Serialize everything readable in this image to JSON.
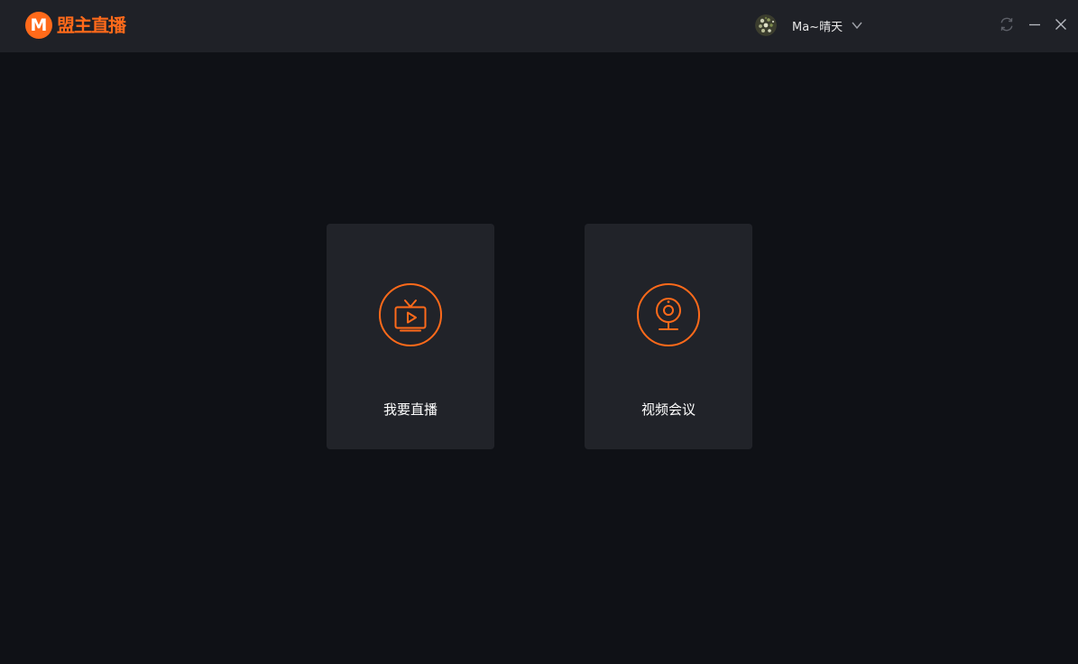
{
  "app": {
    "title": "盟主直播",
    "logo_letter": "M",
    "brand_color": "#ff6a1a"
  },
  "user": {
    "name": "Ma~晴天",
    "avatar_icon": "avatar-image",
    "dropdown_icon": "chevron-down-icon"
  },
  "window_controls": {
    "refresh_icon": "refresh-icon",
    "minimize_icon": "minimize-icon",
    "close_icon": "close-icon"
  },
  "cards": [
    {
      "label": "我要直播",
      "icon": "tv-play-icon"
    },
    {
      "label": "视频会议",
      "icon": "webcam-icon"
    }
  ],
  "colors": {
    "background": "#0f1116",
    "titlebar": "#1f2127",
    "card": "#212329",
    "accent": "#ff6a1a",
    "text": "#ffffff"
  }
}
